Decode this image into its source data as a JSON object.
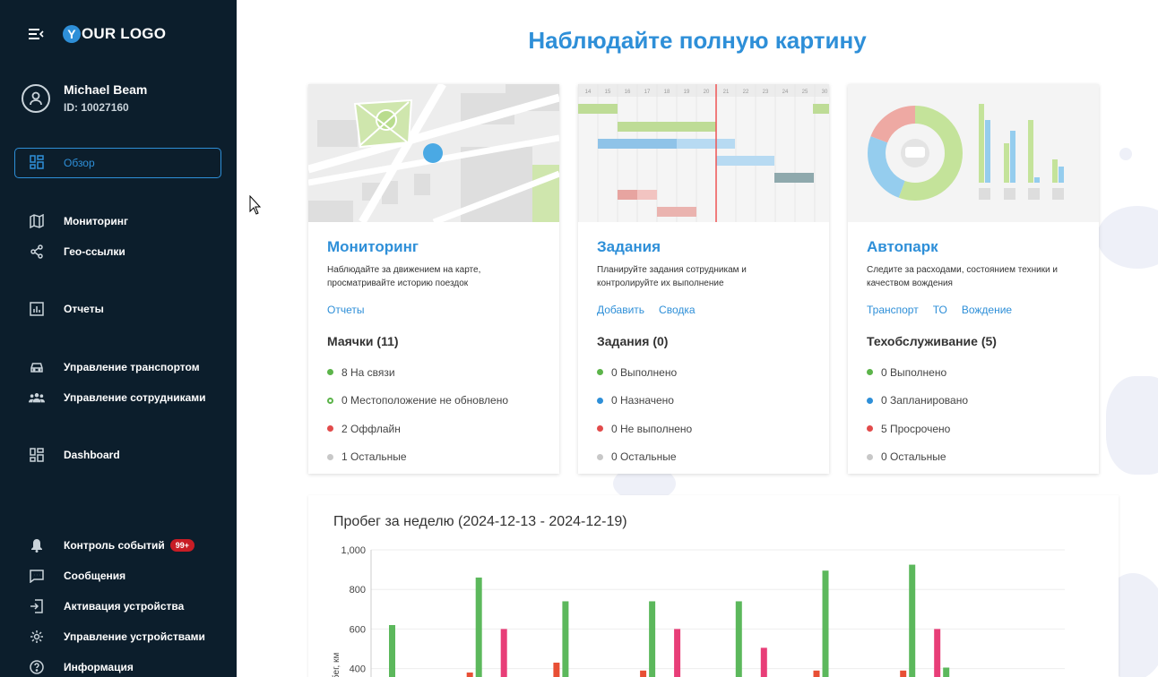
{
  "sidebar": {
    "logo_text": "OUR LOGO",
    "logo_letter": "Y",
    "user": {
      "name": "Michael Beam",
      "id": "ID: 10027160"
    },
    "active_item": {
      "label": "Обзор",
      "icon": "dashboard-grid-icon"
    },
    "items": [
      {
        "label": "Мониторинг",
        "icon": "map-icon"
      },
      {
        "label": "Гео-ссылки",
        "icon": "share-icon"
      },
      {
        "label": "Отчеты",
        "icon": "chart-icon"
      },
      {
        "label": "Управление транспортом",
        "icon": "car-icon"
      },
      {
        "label": "Управление сотрудниками",
        "icon": "people-icon"
      },
      {
        "label": "Dashboard",
        "icon": "dashboard-icon"
      },
      {
        "label": "Контроль событий",
        "icon": "bell-icon",
        "badge": "99+"
      },
      {
        "label": "Сообщения",
        "icon": "message-icon"
      },
      {
        "label": "Активация устройства",
        "icon": "login-icon"
      },
      {
        "label": "Управление устройствами",
        "icon": "gear-icon"
      },
      {
        "label": "Информация",
        "icon": "help-icon"
      }
    ]
  },
  "main": {
    "title": "Наблюдайте полную картину",
    "cards": [
      {
        "title": "Мониторинг",
        "desc": "Наблюдайте за движением на карте, просматривайте историю поездок",
        "links": [
          "Отчеты"
        ],
        "stat_title": "Маячки (11)",
        "stats": [
          {
            "text": "8 На связи",
            "color": "#5cb44a",
            "hollow": false
          },
          {
            "text": "0 Местоположение не обновлено",
            "color": "#5cb44a",
            "hollow": true
          },
          {
            "text": "2 Оффлайн",
            "color": "#e24b4b",
            "hollow": false
          },
          {
            "text": "1 Остальные",
            "color": "#c8c8c8",
            "hollow": false
          }
        ]
      },
      {
        "title": "Задания",
        "desc": "Планируйте задания сотрудникам и контролируйте их выполнение",
        "links": [
          "Добавить",
          "Сводка"
        ],
        "stat_title": "Задания (0)",
        "gantt_days": [
          "14",
          "15",
          "16",
          "17",
          "18",
          "19",
          "20",
          "21",
          "22",
          "23",
          "24",
          "25",
          "30"
        ],
        "stats": [
          {
            "text": "0 Выполнено",
            "color": "#5cb44a",
            "hollow": false
          },
          {
            "text": "0 Назначено",
            "color": "#2e8fd8",
            "hollow": false
          },
          {
            "text": "0 Не выполнено",
            "color": "#e24b4b",
            "hollow": false
          },
          {
            "text": "0 Остальные",
            "color": "#c8c8c8",
            "hollow": false
          }
        ]
      },
      {
        "title": "Автопарк",
        "desc": "Следите за расходами, состоянием техники и качеством вождения",
        "links": [
          "Транспорт",
          "ТО",
          "Вождение"
        ],
        "stat_title": "Техобслуживание (5)",
        "stats": [
          {
            "text": "0 Выполнено",
            "color": "#5cb44a",
            "hollow": false
          },
          {
            "text": "0 Запланировано",
            "color": "#2e8fd8",
            "hollow": false
          },
          {
            "text": "5 Просрочено",
            "color": "#e24b4b",
            "hollow": false
          },
          {
            "text": "0 Остальные",
            "color": "#c8c8c8",
            "hollow": false
          }
        ]
      }
    ]
  },
  "chart_data": {
    "type": "bar",
    "title": "Пробег за неделю (2024-12-13 - 2024-12-19)",
    "ylabel": "Пробег, км",
    "ylim": [
      0,
      1000
    ],
    "yticks": [
      "1,000",
      "800",
      "600",
      "400"
    ],
    "groups": 7,
    "series": [
      {
        "color": "#e84f35",
        "values": [
          0,
          380,
          430,
          390,
          0,
          390,
          390
        ]
      },
      {
        "color": "#5cb85c",
        "values": [
          620,
          860,
          740,
          740,
          740,
          895,
          925
        ]
      },
      {
        "color": "#e83e78",
        "values": [
          0,
          600,
          0,
          600,
          505,
          0,
          600
        ]
      },
      {
        "color": "#5cb85c",
        "values": [
          0,
          0,
          0,
          0,
          0,
          0,
          405
        ]
      }
    ]
  }
}
